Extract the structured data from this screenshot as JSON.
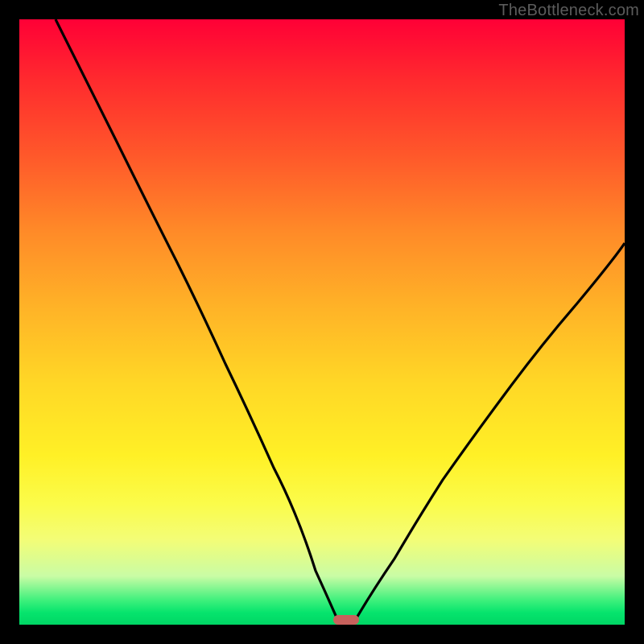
{
  "watermark": "TheBottleneck.com",
  "marker": {
    "x_pct": 54,
    "y_pct": 99.2,
    "color": "#c7615c"
  },
  "chart_data": {
    "type": "line",
    "title": "",
    "xlabel": "",
    "ylabel": "",
    "xlim": [
      0,
      100
    ],
    "ylim": [
      0,
      100
    ],
    "grid": false,
    "legend": false,
    "series": [
      {
        "name": "left-curve",
        "x": [
          6,
          10,
          16,
          22,
          26,
          30,
          34,
          38,
          42,
          46,
          49,
          51,
          53
        ],
        "y": [
          100,
          92,
          80,
          68,
          60,
          52,
          43,
          35,
          26,
          17,
          9,
          4,
          0
        ]
      },
      {
        "name": "right-curve",
        "x": [
          55,
          58,
          62,
          66,
          70,
          75,
          80,
          86,
          92,
          98,
          100
        ],
        "y": [
          0,
          5,
          11,
          18,
          24,
          31,
          38,
          46,
          53,
          60,
          63
        ]
      }
    ],
    "annotations": [
      {
        "type": "marker",
        "shape": "pill",
        "x": 54,
        "y": 0.8,
        "color": "#c7615c"
      }
    ]
  }
}
